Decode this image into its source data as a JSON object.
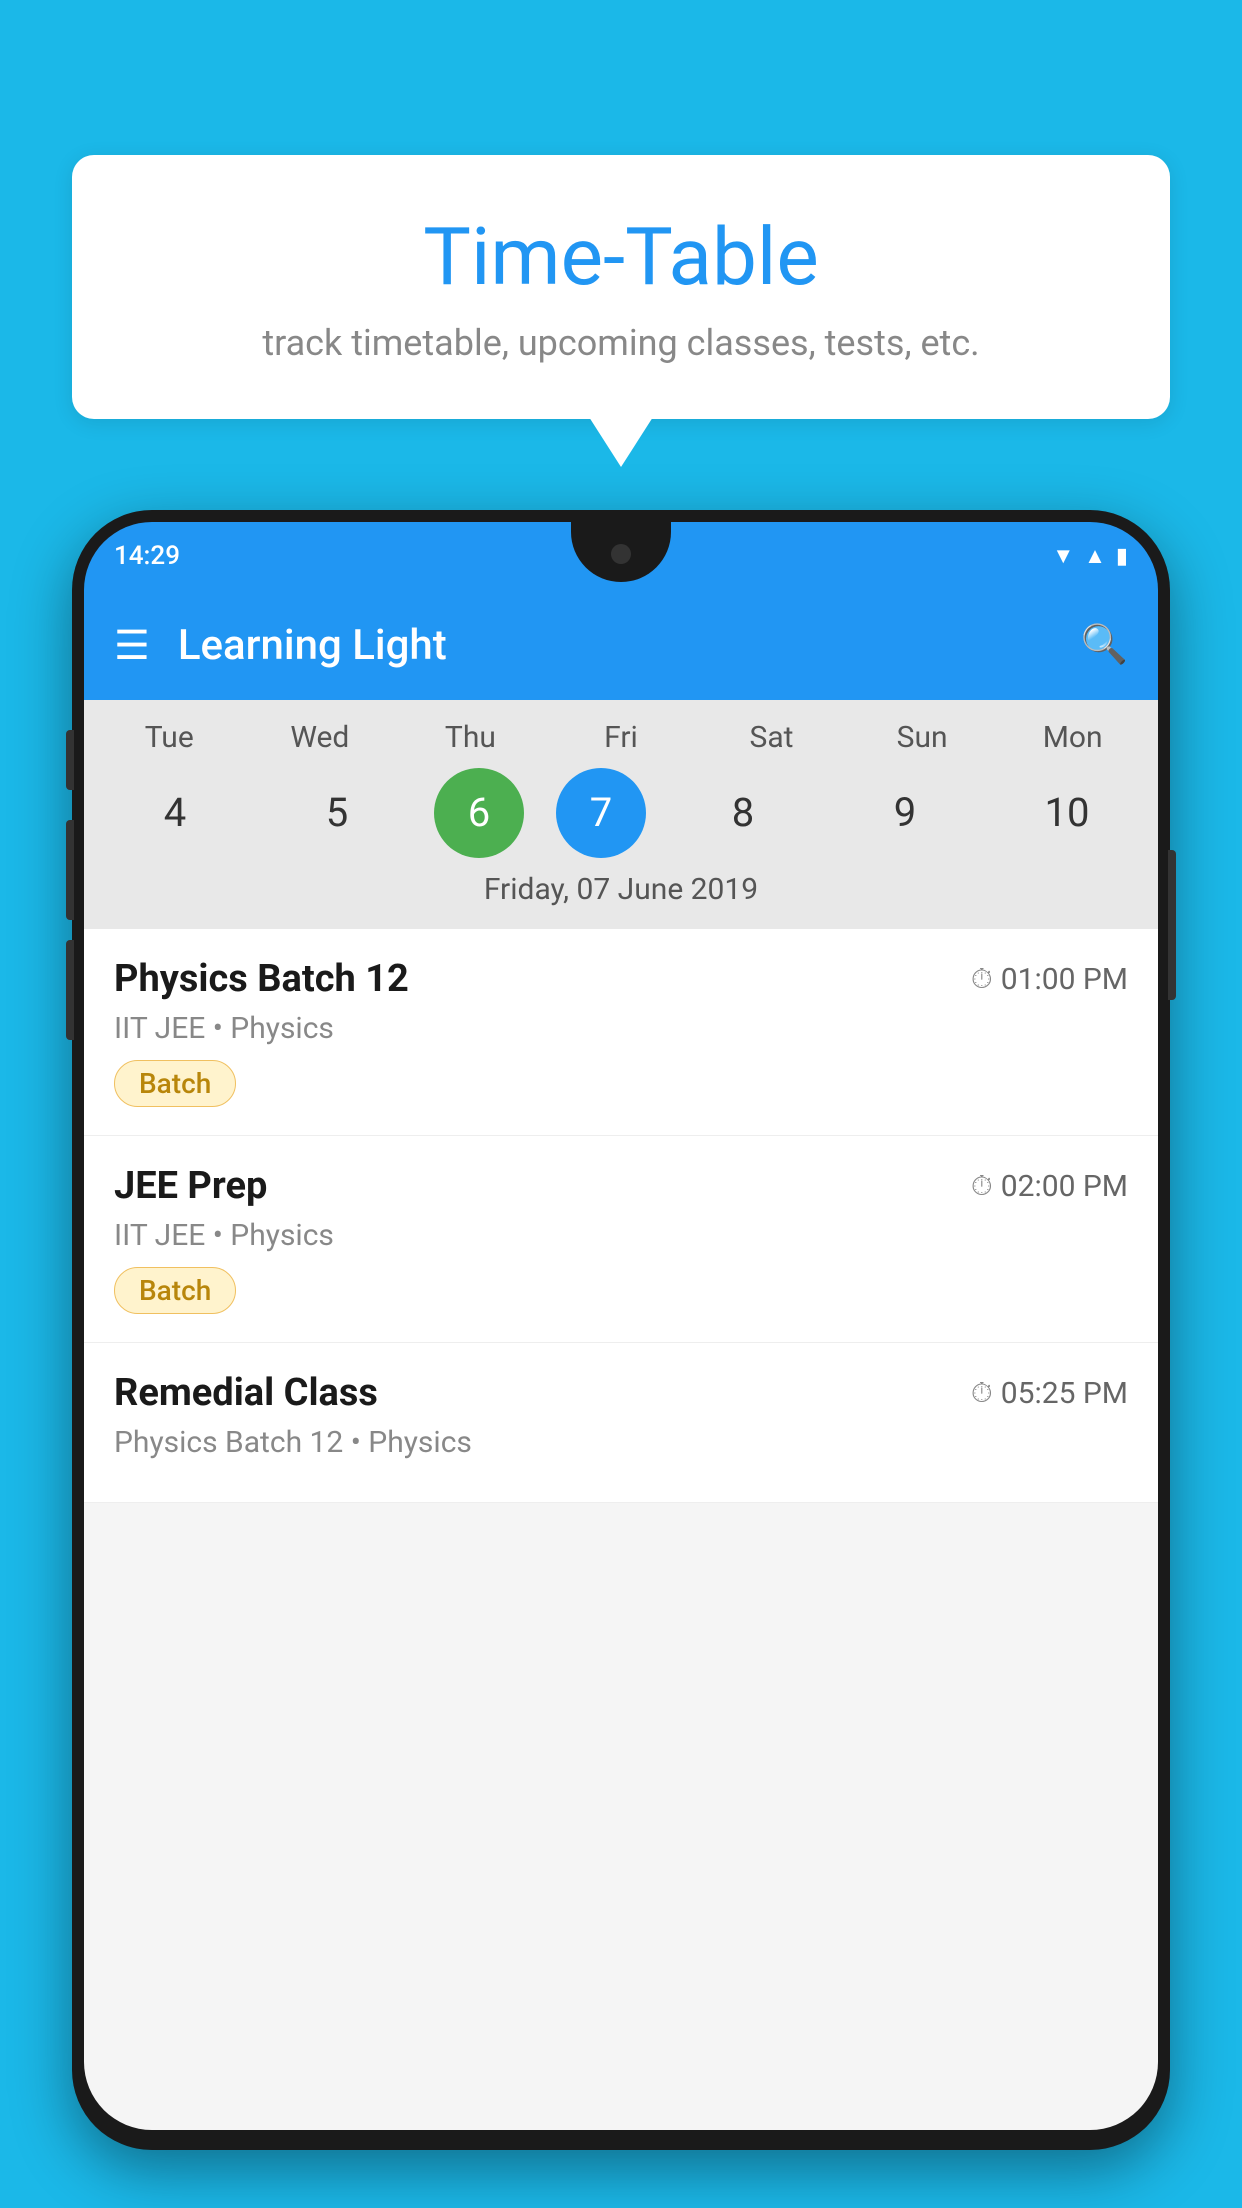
{
  "page": {
    "background_color": "#1BB8E8"
  },
  "bubble": {
    "title": "Time-Table",
    "subtitle": "track timetable, upcoming classes, tests, etc."
  },
  "phone": {
    "status_bar": {
      "time": "14:29"
    },
    "app_bar": {
      "title": "Learning Light"
    },
    "calendar": {
      "days": [
        {
          "name": "Tue",
          "number": "4",
          "state": "normal"
        },
        {
          "name": "Wed",
          "number": "5",
          "state": "normal"
        },
        {
          "name": "Thu",
          "number": "6",
          "state": "today"
        },
        {
          "name": "Fri",
          "number": "7",
          "state": "selected"
        },
        {
          "name": "Sat",
          "number": "8",
          "state": "normal"
        },
        {
          "name": "Sun",
          "number": "9",
          "state": "normal"
        },
        {
          "name": "Mon",
          "number": "10",
          "state": "normal"
        }
      ],
      "selected_date_label": "Friday, 07 June 2019"
    },
    "schedule": [
      {
        "title": "Physics Batch 12",
        "time": "01:00 PM",
        "sub": "IIT JEE • Physics",
        "badge": "Batch"
      },
      {
        "title": "JEE Prep",
        "time": "02:00 PM",
        "sub": "IIT JEE • Physics",
        "badge": "Batch"
      },
      {
        "title": "Remedial Class",
        "time": "05:25 PM",
        "sub": "Physics Batch 12 • Physics",
        "badge": null
      }
    ]
  }
}
